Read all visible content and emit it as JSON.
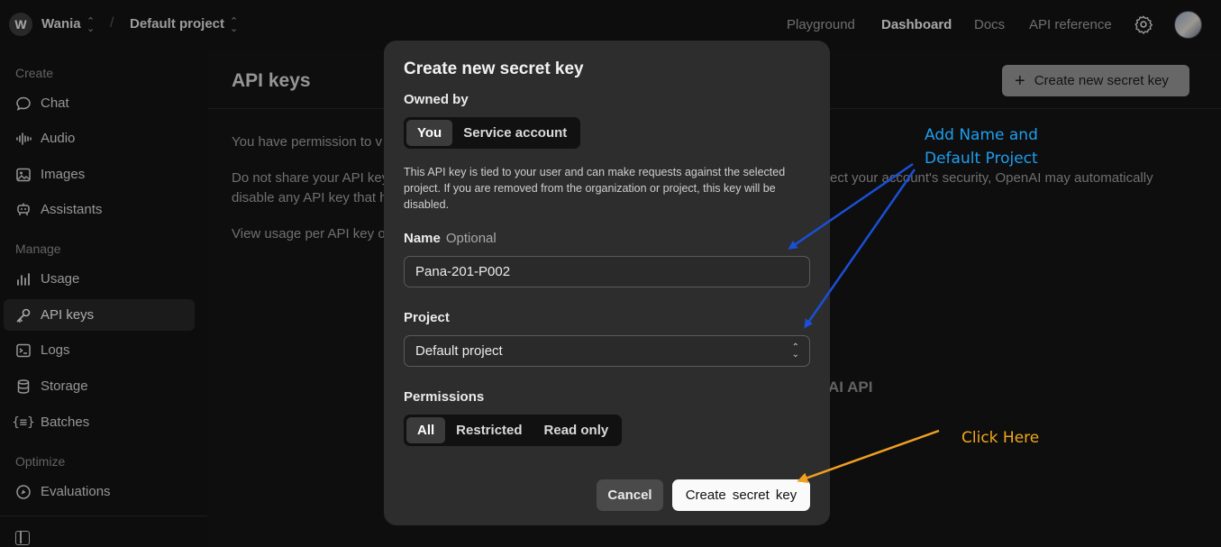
{
  "topbar": {
    "org_initial": "W",
    "org_name": "Wania",
    "separator": "/",
    "project_name": "Default project",
    "nav": [
      "Playground",
      "Dashboard",
      "Docs",
      "API reference"
    ],
    "active_nav": "Dashboard",
    "icons": {
      "settings": "gear-icon",
      "user": "user-avatar"
    }
  },
  "sidebar": {
    "sections": [
      {
        "label": "Create",
        "items": [
          {
            "label": "Chat",
            "icon": "chat-bubble-icon"
          },
          {
            "label": "Audio",
            "icon": "waveform-icon"
          },
          {
            "label": "Images",
            "icon": "image-icon"
          },
          {
            "label": "Assistants",
            "icon": "robot-icon"
          }
        ]
      },
      {
        "label": "Manage",
        "items": [
          {
            "label": "Usage",
            "icon": "bar-chart-icon"
          },
          {
            "label": "API keys",
            "icon": "key-icon",
            "active": true
          },
          {
            "label": "Logs",
            "icon": "terminal-icon"
          },
          {
            "label": "Storage",
            "icon": "database-icon"
          },
          {
            "label": "Batches",
            "icon": "braces-icon"
          }
        ]
      },
      {
        "label": "Optimize",
        "items": [
          {
            "label": "Evaluations",
            "icon": "target-icon"
          }
        ]
      }
    ]
  },
  "main": {
    "title": "API keys",
    "create_button": "Create new  secret  key",
    "para1": "You have permission to v",
    "para2_left": "Do not share your API key",
    "para2_right": "ect your account's security, OpenAI may automatically",
    "para3": "disable any API key that h",
    "para4": "View usage per API key o",
    "partial_heading": "AI API"
  },
  "modal": {
    "title": "Create new secret key",
    "owned_by_label": "Owned by",
    "owned_options": [
      "You",
      "Service account"
    ],
    "owned_selected": "You",
    "description": "This API key is tied to your user and can make requests against the selected project. If you are removed from the organization or project, this key will be disabled.",
    "name_label": "Name",
    "name_optional": "Optional",
    "name_value": "Pana-201-P002",
    "project_label": "Project",
    "project_value": "Default project",
    "permissions_label": "Permissions",
    "permission_options": [
      "All",
      "Restricted",
      "Read only"
    ],
    "permission_selected": "All",
    "cancel_label": "Cancel",
    "confirm_label": "Create  secret  key"
  },
  "annotations": {
    "note1": [
      "Add Name and",
      "Default Project"
    ],
    "note1_color": "#1e9ef0",
    "note2": "Click Here",
    "note2_color": "#f0a81c",
    "arrow_blue": "#1a4fd6",
    "arrow_orange": "#f0a020"
  }
}
